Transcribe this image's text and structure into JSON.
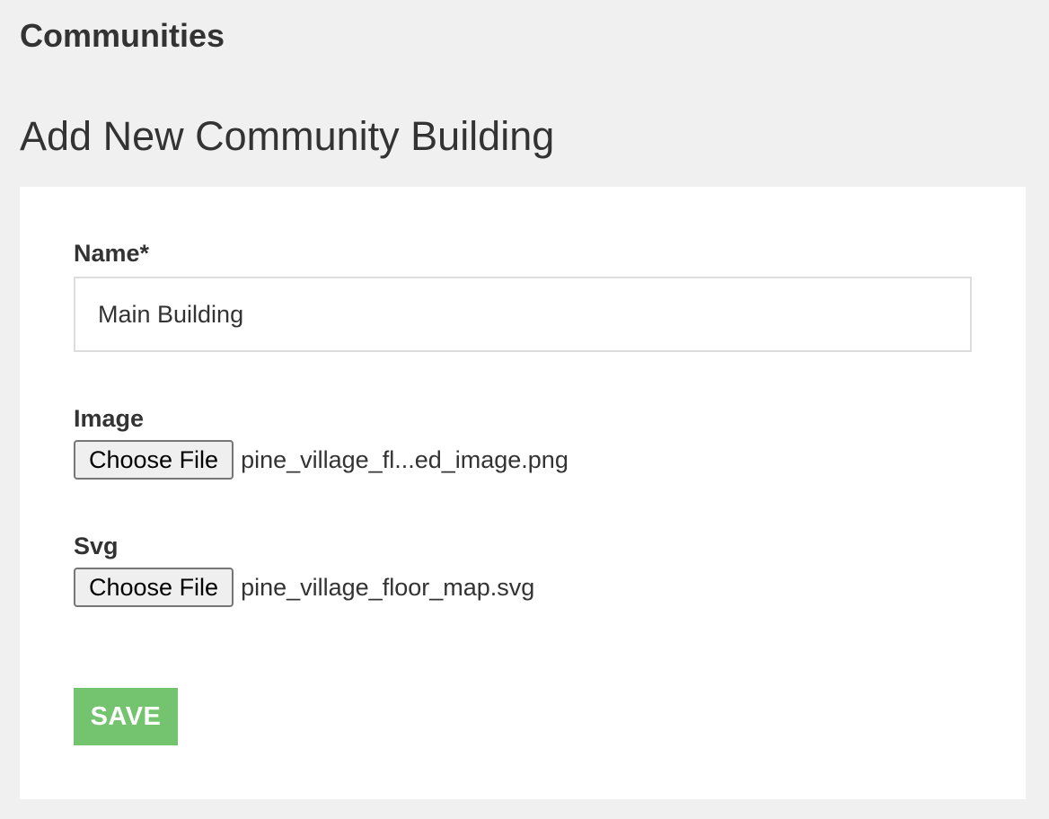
{
  "header": {
    "section_title": "Communities",
    "page_title": "Add New Community Building"
  },
  "form": {
    "name": {
      "label": "Name*",
      "value": "Main Building"
    },
    "image": {
      "label": "Image",
      "button_label": "Choose File",
      "file_name": "pine_village_fl...ed_image.png"
    },
    "svg": {
      "label": "Svg",
      "button_label": "Choose File",
      "file_name": "pine_village_floor_map.svg"
    },
    "save_label": "SAVE"
  },
  "colors": {
    "background": "#f0f0f0",
    "card": "#ffffff",
    "text": "#333333",
    "save_button": "#74c36f",
    "input_border": "#dddddd"
  }
}
